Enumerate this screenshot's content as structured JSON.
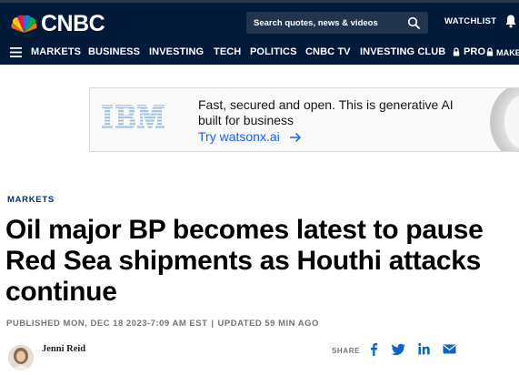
{
  "header": {
    "logo_text": "CNBC",
    "search": {
      "placeholder": "Search quotes, news & videos"
    },
    "watchlist_label": "WATCHLIST",
    "nav_items": [
      "MARKETS",
      "BUSINESS",
      "INVESTING",
      "TECH",
      "POLITICS",
      "CNBC TV",
      "INVESTING CLUB",
      "PRO",
      "MAKE IT"
    ]
  },
  "ad": {
    "brand": "IBM",
    "text": "Fast, secured and open. This is generative AI built for business",
    "cta": "Try watsonx.ai"
  },
  "article": {
    "section": "MARKETS",
    "headline": "Oil major BP becomes latest to pause Red Sea shipments as Houthi attacks continue",
    "published": "PUBLISHED MON, DEC 18 2023-7:09 AM EST",
    "separator": "|",
    "updated": "UPDATED 59 MIN AGO",
    "author": "Jenni Reid",
    "share_label": "SHARE"
  },
  "colors": {
    "header_bg": "#001a3a",
    "search_bg": "#23354e",
    "section_label": "#002f6c",
    "ibm_blue": "#1f70c1",
    "cta_blue": "#0f62fe",
    "share_blue": "#0a66c2"
  },
  "icons": [
    "nbc-peacock-logo",
    "search-icon",
    "bell-icon",
    "menu-icon",
    "lock-icon",
    "ibm-logo",
    "arrow-right-icon",
    "facebook-icon",
    "twitter-icon",
    "linkedin-icon",
    "email-icon"
  ]
}
